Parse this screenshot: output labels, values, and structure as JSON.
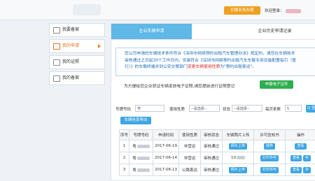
{
  "header": {
    "switch_button": "切换业务办理",
    "welcome_prefix": "欢迎登录："
  },
  "sidebar": {
    "items": [
      {
        "label": "我要备案",
        "active": false
      },
      {
        "label": "我的申请",
        "active": true
      },
      {
        "label": "我的证照",
        "active": false
      },
      {
        "label": "我的备案",
        "active": false
      }
    ]
  },
  "tabs": [
    {
      "label": "企业车辆申请",
      "active": true
    },
    {
      "label": "企业历史申请记录",
      "active": false
    }
  ],
  "notice": {
    "line1": "您公司申请的车辆技术条件符合《深圳市网络预约出租汽车管理办法》规定的，请您在车辆技术",
    "line2": "审核通过之日起30个工作日内，安装符合《深圳市网络预约出租汽车车载专用设备配置指引（暂",
    "line3_normal": "行）》的车载终端并到公安交警部门",
    "line3_red": "变更车辆使用性质",
    "line3_tail": "为\"预约出租客运\"。"
  },
  "verify": {
    "text": "为方便给您企业获证车辆发放电子证照,请您提前进行证照登记",
    "button": "申报电子证件"
  },
  "filters": {
    "plate_label": "号牌号码",
    "plate_value": "粤",
    "usage_label": "使用性质",
    "usage_value": "--请选择--",
    "status_label": "状态",
    "status_value": "--请选择--",
    "pagesize_label": "每页条数",
    "pagesize_value": "5",
    "search_button": "Q 查询"
  },
  "export_button": "车辆信息导出",
  "table": {
    "headers": [
      "序号",
      "号牌号码",
      "申请时间",
      "使用性质",
      "审核状态",
      "车辆照片上传",
      "许可告知书",
      "操作"
    ],
    "rows": [
      {
        "index": "1",
        "plate": "粤",
        "date": "2017-06-19",
        "usage": "非营运",
        "status": "审核通过",
        "photo": "照片上传",
        "notice": "放弃",
        "ops": [
          "查看"
        ]
      },
      {
        "index": "2",
        "plate": "粤",
        "date": "2017-06-14",
        "usage": "非营运",
        "status": "审核通过",
        "photo": "10",
        "notice": "打印许可",
        "ops": [
          "查看",
          "补"
        ]
      },
      {
        "index": "3",
        "plate": "粤",
        "date": "2017-06-13",
        "usage": "公路客运",
        "status": "审核通过",
        "photo": "照片上传",
        "notice": "打印许可",
        "ops": [
          "查看",
          "补"
        ]
      }
    ]
  }
}
